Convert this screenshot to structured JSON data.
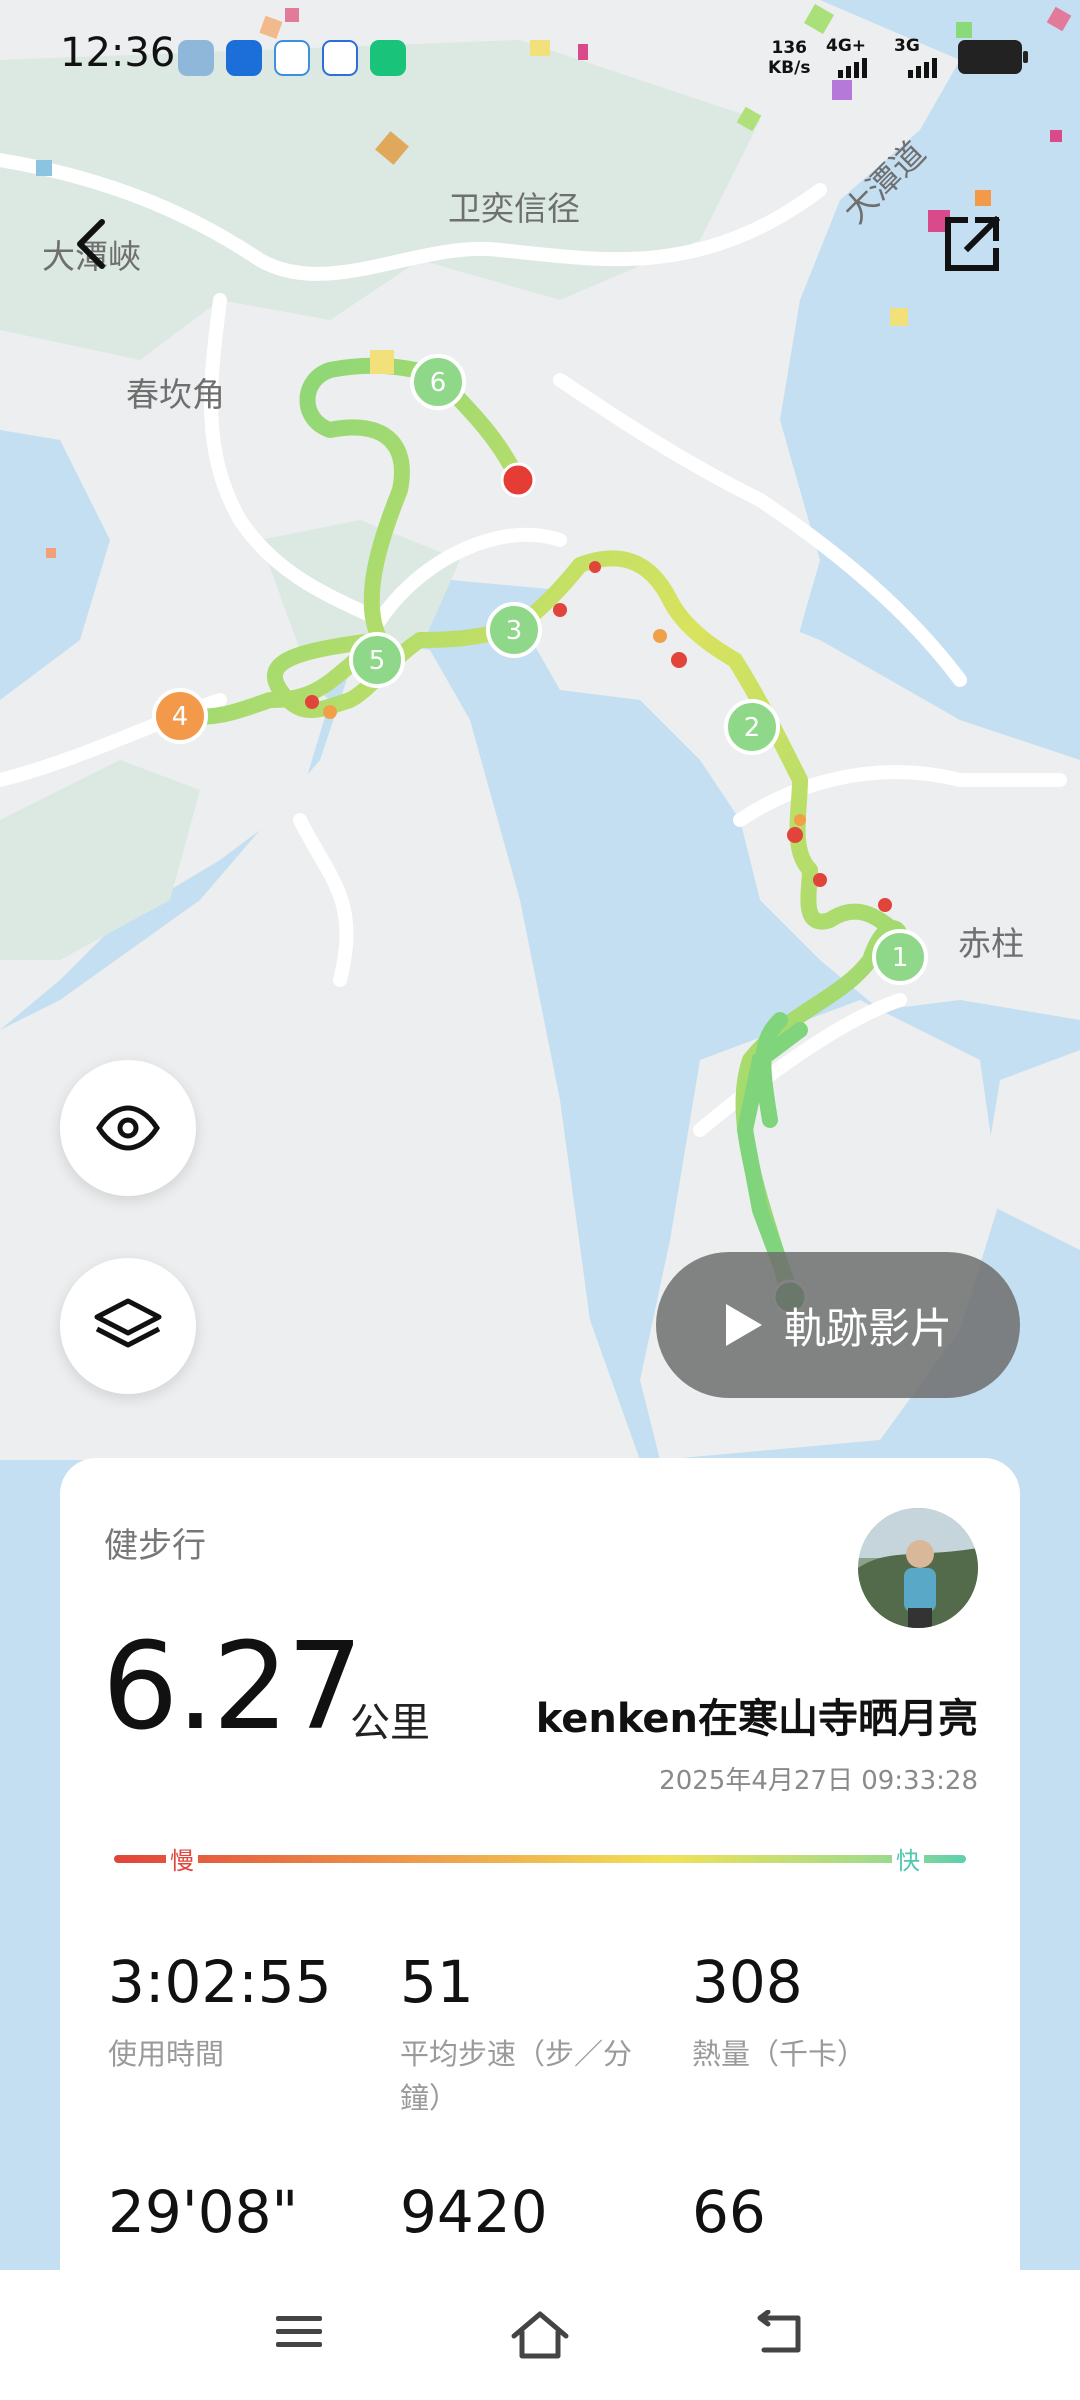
{
  "status_bar": {
    "time": "12:36",
    "net_speed_value": "136",
    "net_speed_unit": "KB/s",
    "signal1": "4G+",
    "signal2": "3G"
  },
  "map": {
    "labels": [
      "大潭峽",
      "卫奕信径",
      "大潭道",
      "春坎角",
      "赤柱"
    ],
    "markers": [
      "1",
      "2",
      "3",
      "4",
      "5",
      "6"
    ]
  },
  "controls": {
    "play_label": "軌跡影片",
    "back_icon": "chevron-left-icon",
    "share_icon": "external-link-icon",
    "eye_icon": "eye-icon",
    "layers_icon": "layers-icon"
  },
  "summary": {
    "sport_type": "健步行",
    "distance": "6.27",
    "distance_unit": "公里",
    "user_name": "kenken在寒山寺晒月亮",
    "datetime": "2025年4月27日 09:33:28",
    "speed_slow": "慢",
    "speed_fast": "快"
  },
  "stats": [
    {
      "value": "3:02:55",
      "label": "使用時間"
    },
    {
      "value": "51",
      "label": "平均步速（步／分鐘）"
    },
    {
      "value": "308",
      "label": "熱量（千卡）"
    },
    {
      "value": "29'08\"",
      "label": ""
    },
    {
      "value": "9420",
      "label": ""
    },
    {
      "value": "66",
      "label": ""
    }
  ],
  "colors": {
    "route_slow": "#e0443a",
    "route_mid": "#f1e159",
    "route_fast": "#7fd47c",
    "marker_green": "#8fd88a",
    "marker_orange": "#f29a4a",
    "marker_end": "#e53d35",
    "water": "#c3dff1",
    "land": "#eceeef",
    "park": "#dbe9e2"
  }
}
